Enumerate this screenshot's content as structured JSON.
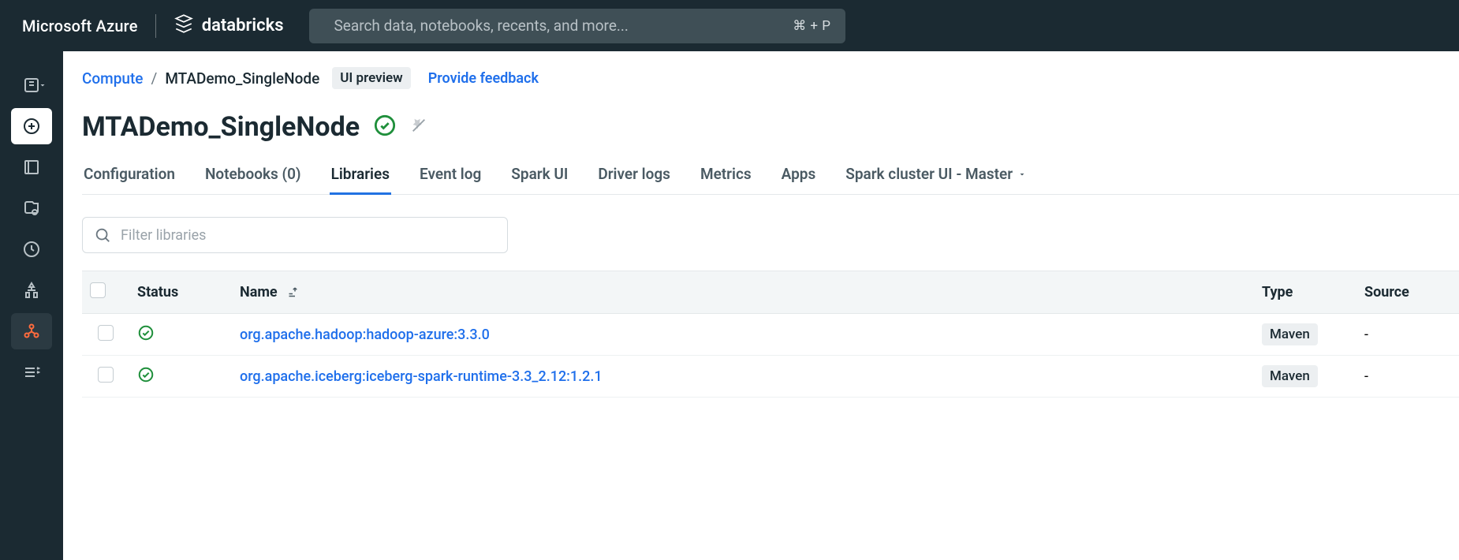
{
  "topbar": {
    "azure_label": "Microsoft Azure",
    "databricks_label": "databricks",
    "search_placeholder": "Search data, notebooks, recents, and more...",
    "search_shortcut": "⌘ + P"
  },
  "breadcrumb": {
    "root": "Compute",
    "sep": "/",
    "current": "MTADemo_SingleNode",
    "preview_badge": "UI preview",
    "feedback": "Provide feedback"
  },
  "title": {
    "text": "MTADemo_SingleNode"
  },
  "tabs": [
    {
      "label": "Configuration",
      "active": false
    },
    {
      "label": "Notebooks (0)",
      "active": false
    },
    {
      "label": "Libraries",
      "active": true
    },
    {
      "label": "Event log",
      "active": false
    },
    {
      "label": "Spark UI",
      "active": false
    },
    {
      "label": "Driver logs",
      "active": false
    },
    {
      "label": "Metrics",
      "active": false
    },
    {
      "label": "Apps",
      "active": false
    },
    {
      "label": "Spark cluster UI - Master",
      "active": false,
      "has_caret": true
    }
  ],
  "filter": {
    "placeholder": "Filter libraries"
  },
  "table": {
    "headers": {
      "status": "Status",
      "name": "Name",
      "type": "Type",
      "source": "Source"
    },
    "rows": [
      {
        "name": "org.apache.hadoop:hadoop-azure:3.3.0",
        "type": "Maven",
        "source": "-"
      },
      {
        "name": "org.apache.iceberg:iceberg-spark-runtime-3.3_2.12:1.2.1",
        "type": "Maven",
        "source": "-"
      }
    ]
  }
}
